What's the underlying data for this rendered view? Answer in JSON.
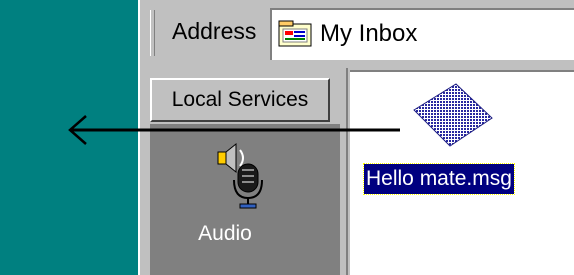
{
  "address_bar": {
    "label": "Address",
    "value": "My Inbox",
    "folder_icon": "inbox-folder-icon"
  },
  "left_pane": {
    "header": "Local Services",
    "items": [
      {
        "label": "Audio",
        "icon": "audio-icon"
      }
    ]
  },
  "main": {
    "files": [
      {
        "label": "Hello mate.msg",
        "icon": "message-file-icon",
        "selected": true
      }
    ]
  },
  "colors": {
    "desktop": "#008080",
    "selection": "#000080",
    "chrome": "#c0c0c0"
  },
  "drag_arrow": {
    "direction": "left"
  }
}
